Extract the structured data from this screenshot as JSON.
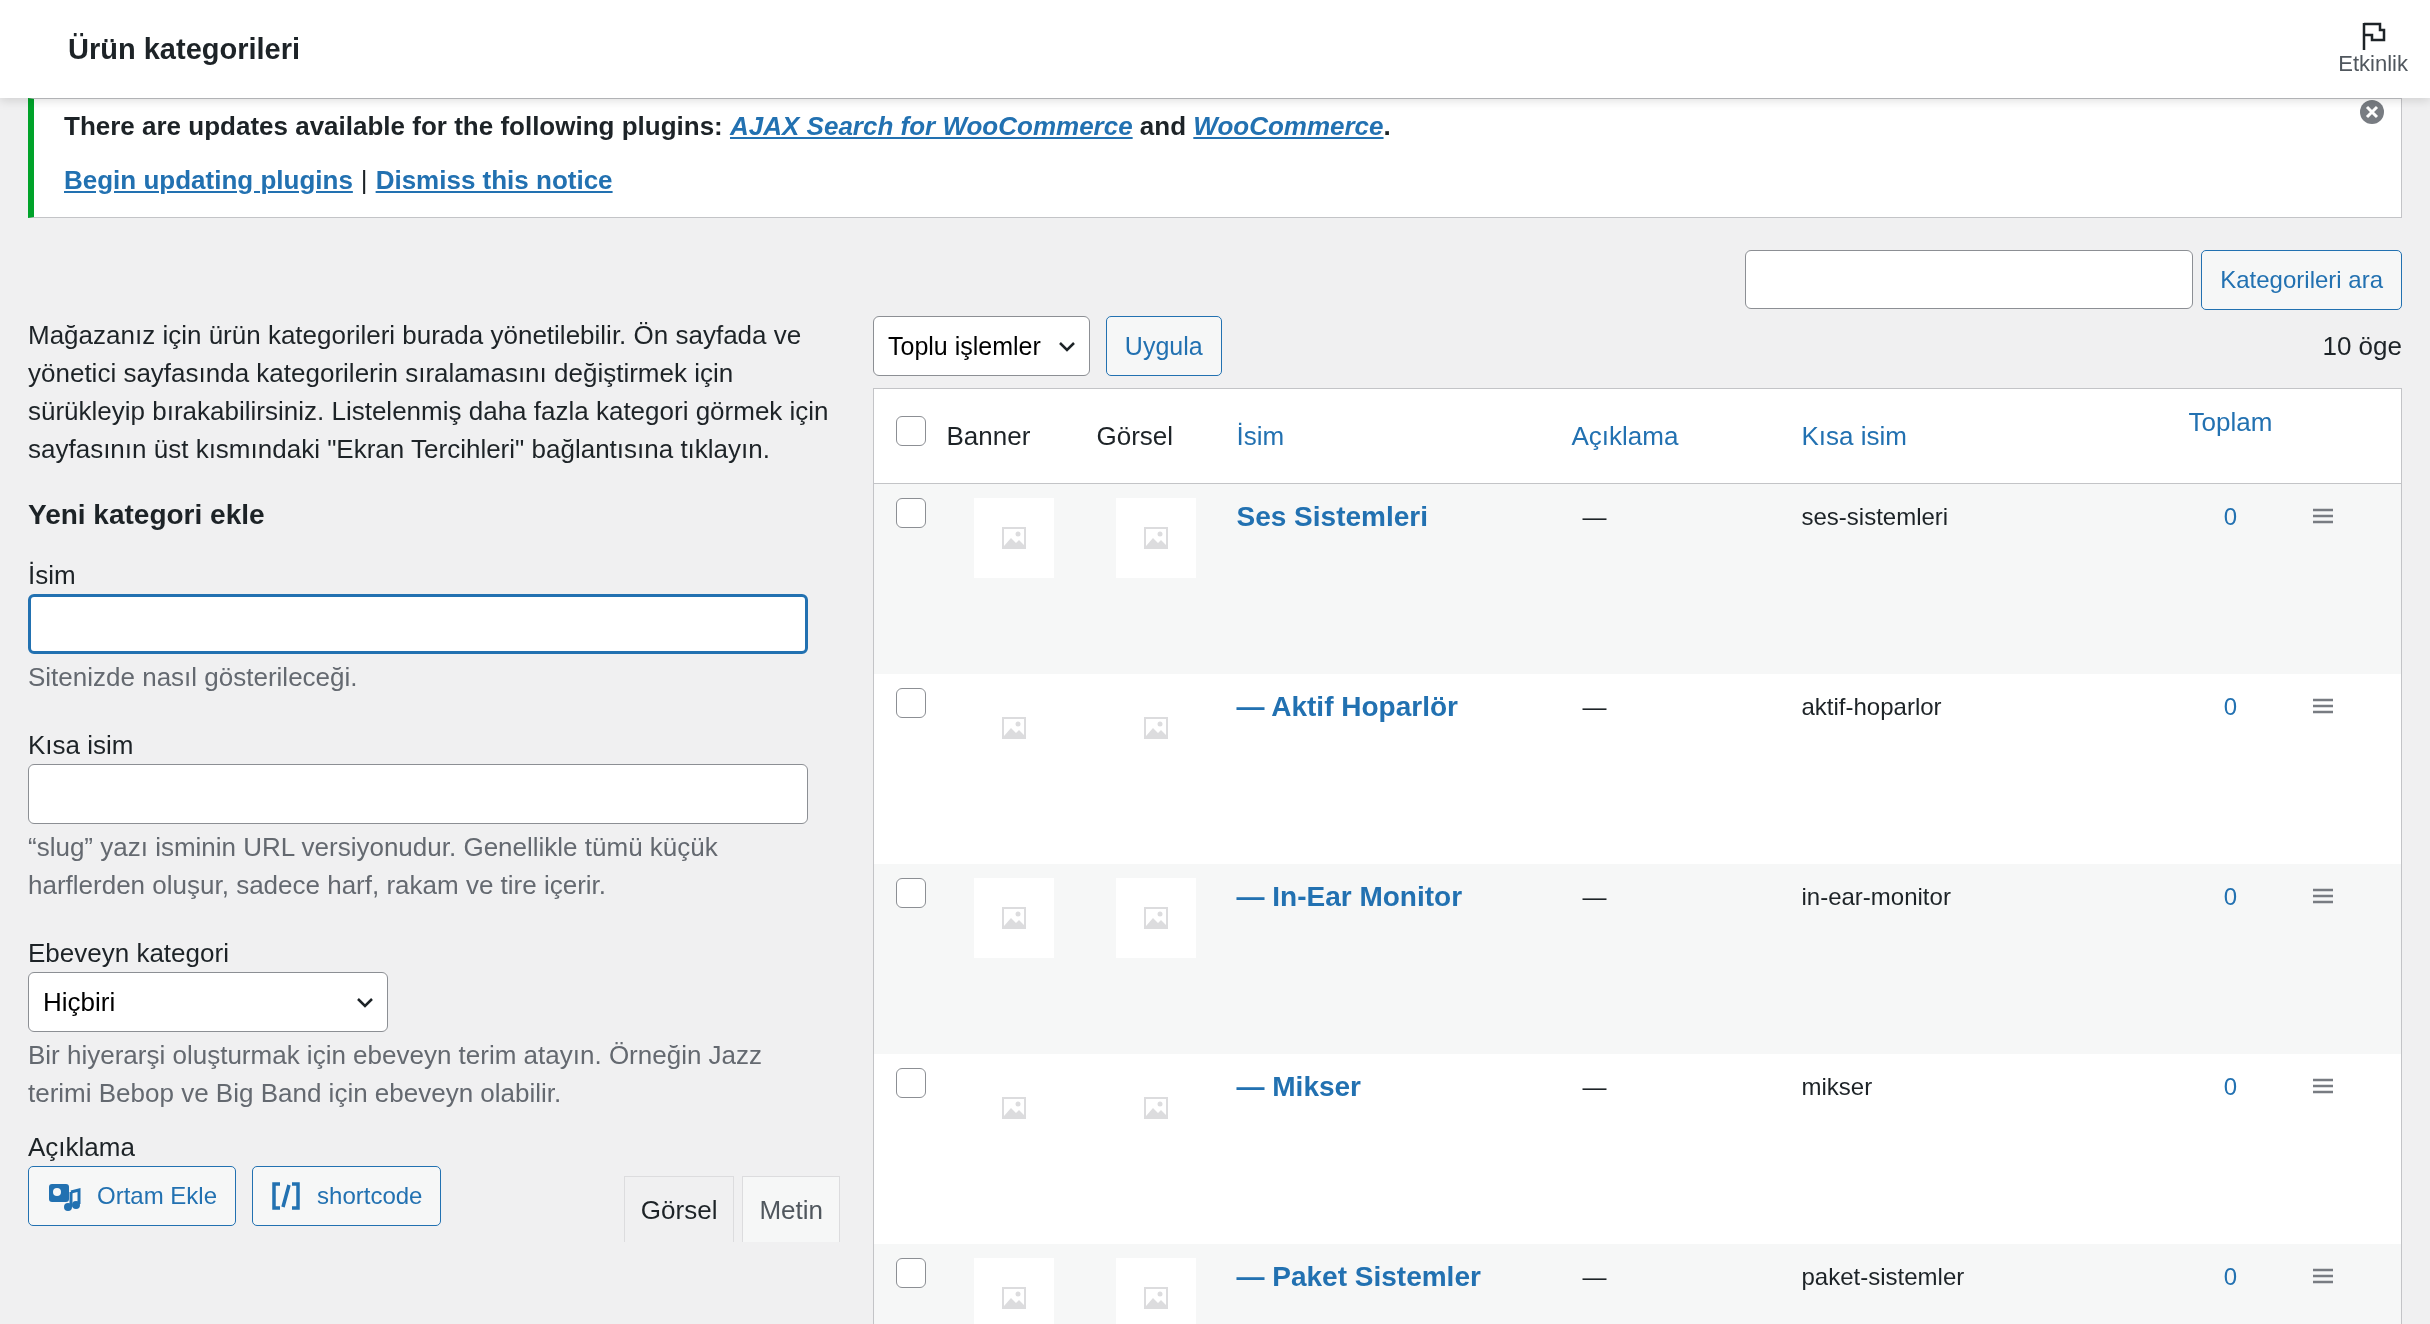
{
  "header": {
    "title": "Ürün kategorileri",
    "activity_label": "Etkinlik"
  },
  "notice": {
    "message_parts": [
      {
        "kind": "text",
        "text": "There are updates available for the following plugins: "
      },
      {
        "kind": "link",
        "text": "AJAX Search for WooCommerce"
      },
      {
        "kind": "text",
        "text": " and "
      },
      {
        "kind": "link",
        "text": "WooCommerce"
      },
      {
        "kind": "text",
        "text": "."
      }
    ],
    "actions": [
      "Begin updating plugins",
      "Dismiss this notice"
    ],
    "separator": "|"
  },
  "search": {
    "button": "Kategorileri ara"
  },
  "intro": "Mağazanız için ürün kategorileri burada yönetilebilir. Ön sayfada ve yönetici sayfasında kategorilerin sıralamasını değiştirmek için sürükleyip bırakabilirsiniz. Listelenmiş daha fazla kategori görmek için sayfasının üst kısmındaki \"Ekran Tercihleri\" bağlantısına tıklayın.",
  "form": {
    "heading": "Yeni kategori ekle",
    "fields": [
      {
        "kind": "text",
        "label": "İsim",
        "focused": true,
        "help": "Sitenizde nasıl gösterileceği."
      },
      {
        "kind": "text",
        "label": "Kısa isim",
        "focused": false,
        "help": "“slug” yazı isminin URL versiyonudur. Genellikle tümü küçük harflerden oluşur, sadece harf, rakam ve tire içerir."
      },
      {
        "kind": "select",
        "label": "Ebeveyn kategori",
        "value": "Hiçbiri",
        "help": "Bir hiyerarşi oluşturmak için ebeveyn terim atayın. Örneğin Jazz terimi Bebop ve Big Band için ebeveyn olabilir."
      }
    ],
    "description": {
      "label": "Açıklama",
      "buttons": [
        {
          "kind": "media",
          "label": "Ortam Ekle"
        },
        {
          "kind": "shortcode",
          "label": "shortcode"
        }
      ],
      "tabs": [
        {
          "label": "Görsel",
          "selected": true
        },
        {
          "label": "Metin",
          "selected": false
        }
      ]
    }
  },
  "bulk": {
    "select": "Toplu işlemler",
    "apply": "Uygula",
    "count": "10 öge"
  },
  "table": {
    "all_selected": false,
    "columns": [
      {
        "label": "Banner",
        "sortable": false
      },
      {
        "label": "Görsel",
        "sortable": false
      },
      {
        "label": "İsim",
        "sortable": true
      },
      {
        "label": "Açıklama",
        "sortable": true
      },
      {
        "label": "Kısa isim",
        "sortable": true
      },
      {
        "label": "Toplam",
        "sortable": true
      }
    ],
    "rows": [
      {
        "name": "Ses Sistemleri",
        "description": "—",
        "slug": "ses-sistemleri",
        "count": "0",
        "selected": false
      },
      {
        "name": "— Aktif Hoparlör",
        "description": "—",
        "slug": "aktif-hoparlor",
        "count": "0",
        "selected": false
      },
      {
        "name": "— In-Ear Monitor",
        "description": "—",
        "slug": "in-ear-monitor",
        "count": "0",
        "selected": false
      },
      {
        "name": "— Mikser",
        "description": "—",
        "slug": "mikser",
        "count": "0",
        "selected": false
      },
      {
        "name": "— Paket Sistemler",
        "description": "—",
        "slug": "paket-sistemler",
        "count": "0",
        "selected": false
      }
    ]
  }
}
